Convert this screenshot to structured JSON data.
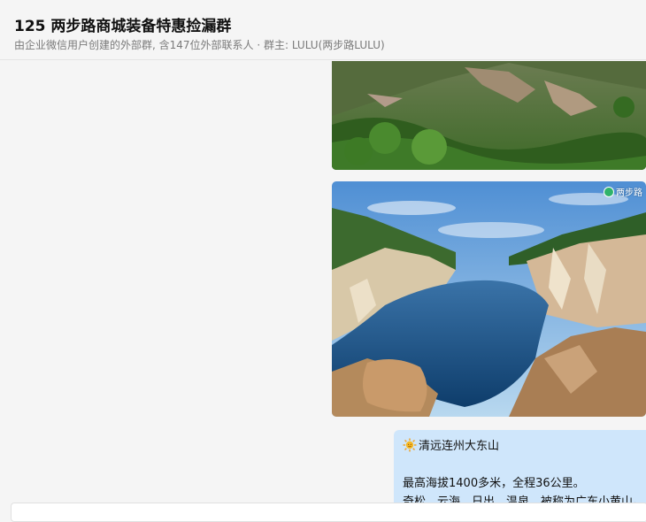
{
  "header": {
    "title": "125 两步路商城装备特惠捡漏群",
    "subtitle": "由企业微信用户创建的外部群, 含147位外部联系人 · 群主: LULU(两步路LULU)"
  },
  "messages": {
    "image1": {
      "alt": "mountain forest slope photo"
    },
    "image2": {
      "alt": "blue lake among cliffs photo",
      "watermark": "两步路"
    },
    "text": {
      "icon": "sun-icon",
      "line1": "清远连州大东山",
      "line2": "最高海拔1400多米，全程36公里。",
      "line3": "奇松、云海、日出、温泉，被称为广东小黄山。"
    }
  },
  "colors": {
    "bubble": "#cfe6fb",
    "background": "#f5f5f5"
  }
}
